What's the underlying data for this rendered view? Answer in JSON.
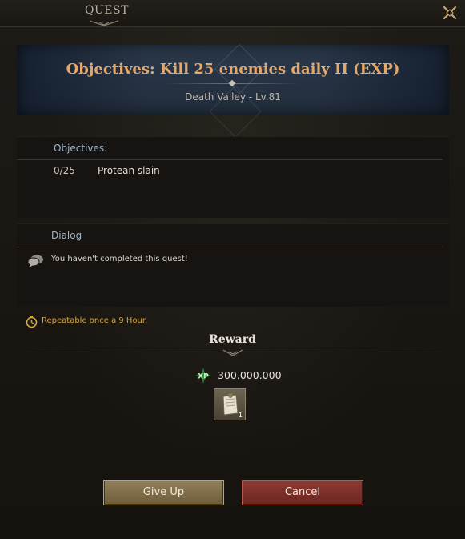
{
  "window": {
    "title": "QUEST"
  },
  "quest": {
    "title": "Objectives: Kill 25 enemies daily II (EXP)",
    "location": "Death Valley - Lv.81"
  },
  "objectives": {
    "header": "Objectives:",
    "items": [
      {
        "progress": "0/25",
        "text": "Protean slain"
      }
    ]
  },
  "dialog": {
    "header": "Dialog",
    "text": "You haven't completed this quest!"
  },
  "repeatable": {
    "text": "Repeatable once a 9 Hour."
  },
  "reward": {
    "title": "Reward",
    "xp_label": "XP",
    "xp_amount": "300.000.000",
    "item_quantity": "1"
  },
  "buttons": {
    "give_up": "Give Up",
    "cancel": "Cancel"
  },
  "colors": {
    "quest_title": "#e6a76a",
    "section_header": "#9fb5c9",
    "repeatable": "#d8a53c",
    "give_up_button": "#93805a",
    "cancel_button": "#8f3a33",
    "xp_green": "#3fae4a"
  },
  "icons": {
    "close": "close-icon",
    "dialog": "speech-bubble-icon",
    "repeat": "stopwatch-icon",
    "xp": "xp-icon",
    "item": "scroll-item-icon"
  }
}
